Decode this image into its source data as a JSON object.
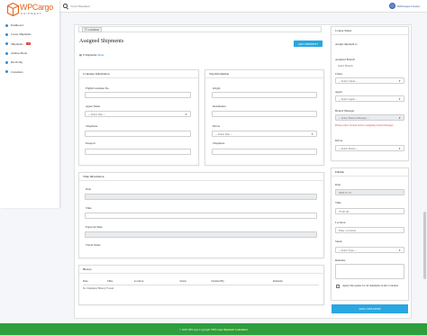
{
  "topbar": {
    "search_placeholder": "Track Shipment",
    "user_name": "Webbusque Cleaner"
  },
  "logo": {
    "name": "WPCargo",
    "tagline": "SHIPMENT"
  },
  "sidebar": {
    "items": [
      {
        "label": "Dashboard"
      },
      {
        "label": "Create Shipments"
      },
      {
        "label": "Shipments",
        "badge": "15"
      },
      {
        "label": "Address Book"
      },
      {
        "label": "Receiving"
      },
      {
        "label": "Customers"
      }
    ]
  },
  "breadcrumb": {
    "selector": "Container"
  },
  "page": {
    "title": "Assigned Shipments",
    "add_button": "ADD SHIPMENT",
    "subline_prefix": "0 Shipments",
    "subline_link": "Show"
  },
  "container_info": {
    "heading": "Container Information",
    "flight_label": "Flight/Container No.",
    "agent_label": "Agent Name",
    "agent_select": "-- Select One --",
    "telephone_label": "Telephone",
    "passport_label": "Passport"
  },
  "trip_info": {
    "heading": "Trip Information",
    "origin_label": "Origin",
    "destination_label": "Destination",
    "driver_label": "Driver",
    "driver_select": "-- Select One --",
    "telephone_label": "Telephone"
  },
  "time_info": {
    "heading": "Time Information",
    "date_label": "Date",
    "time_label": "Time",
    "expected_label": "Expected Date",
    "travel_mode_label": "Travel Mode"
  },
  "history": {
    "heading": "History",
    "columns": [
      "Date",
      "Time",
      "Location",
      "Status",
      "Updated By",
      "Remarks"
    ],
    "empty_text": "No Shipment History Found"
  },
  "container_status": {
    "heading": "Course Status",
    "assign_label": "Assign shipment to",
    "assigned_branch_label": "Assigned Branch",
    "branch_select": "Select Branch",
    "client_label": "Client",
    "client_select": "-- Select Client --",
    "agent_label": "Agent",
    "agent_select": "-- Select Agent --",
    "manager_label": "Branch Manager",
    "manager_select": "-- Select Branch Manager --",
    "warning": "Please select branch before assigning branch manager",
    "driver_label": "Driver",
    "driver_select": "-- Select Driver --"
  },
  "publish": {
    "heading": "Publish",
    "date_label": "Date",
    "date_value": "2020-07-31",
    "time_label": "Time",
    "time_value": "07:40 am",
    "location_label": "Location",
    "location_placeholder": "Enter a location",
    "status_label": "Status",
    "status_select": "-- Select Type --",
    "remarks_label": "Remarks",
    "apply_label": "Apply this update for all shipments in the Container",
    "add_button": "ADD CONTAINER"
  },
  "footer": {
    "text": "© 2020 WPCargo Copyright",
    "brand": "WPCargo Shipment Containers"
  },
  "colors": {
    "accent": "#2aa6e0",
    "footer": "#2e9e3e",
    "brand": "#e2671f",
    "warning": "#e53935"
  }
}
